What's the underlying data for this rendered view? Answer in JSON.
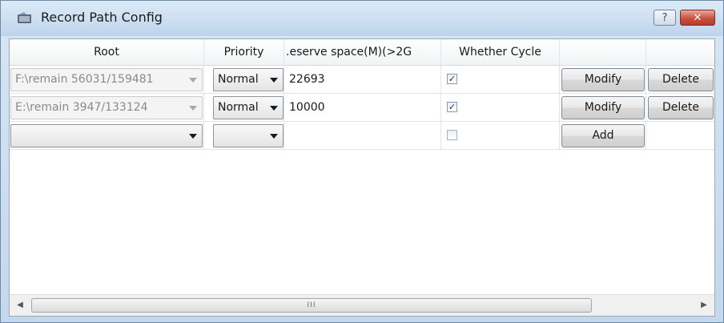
{
  "window": {
    "title": "Record Path Config"
  },
  "table": {
    "headers": [
      "Root",
      "Priority",
      ".eserve space(M)(>2G",
      "Whether Cycle",
      "",
      ""
    ],
    "rows": [
      {
        "root": "F:\\remain 56031/159481",
        "priority": "Normal",
        "reserve": "22693",
        "cycle": true,
        "modify_label": "Modify",
        "delete_label": "Delete"
      },
      {
        "root": "E:\\remain 3947/133124",
        "priority": "Normal",
        "reserve": "10000",
        "cycle": true,
        "modify_label": "Modify",
        "delete_label": "Delete"
      },
      {
        "root": "",
        "priority": "",
        "reserve": "",
        "cycle": false,
        "add_label": "Add"
      }
    ]
  },
  "scrollbar": {
    "grip": "III"
  },
  "icons": {
    "help": "?",
    "close": "✕",
    "check": "✓"
  },
  "colors": {
    "accent": "#c4d9ee",
    "close": "#c75340"
  }
}
